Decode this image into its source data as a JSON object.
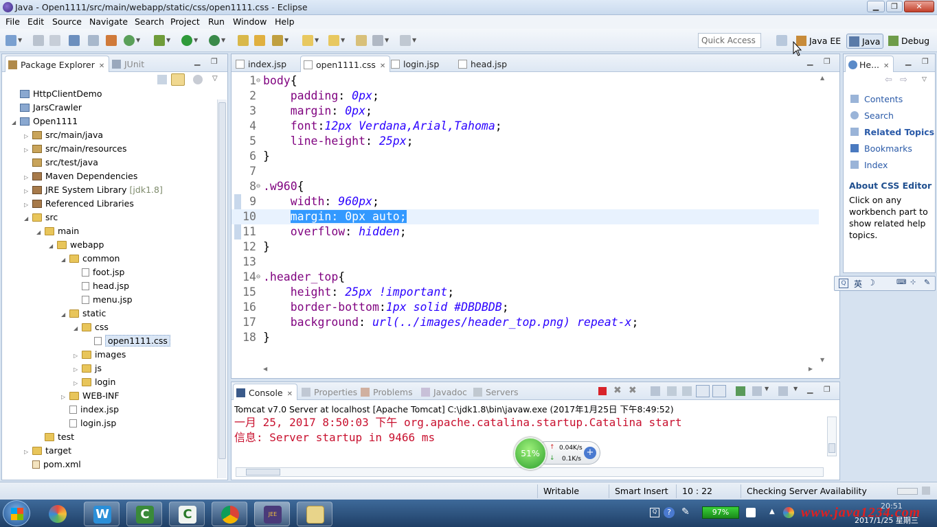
{
  "window": {
    "title": "Java - Open1111/src/main/webapp/static/css/open1111.css - Eclipse"
  },
  "menu": [
    "File",
    "Edit",
    "Source",
    "Navigate",
    "Search",
    "Project",
    "Run",
    "Window",
    "Help"
  ],
  "toolbar": {
    "quick_access": "Quick Access",
    "perspectives": [
      {
        "label": "Java EE"
      },
      {
        "label": "Java",
        "active": true
      },
      {
        "label": "Debug"
      }
    ]
  },
  "left_panel": {
    "tabs": [
      {
        "label": "Package Explorer",
        "active": true
      },
      {
        "label": "JUnit"
      }
    ],
    "tree": [
      {
        "label": "HttpClientDemo",
        "depth": 0,
        "icon": "project-icon",
        "arrow": ""
      },
      {
        "label": "JarsCrawler",
        "depth": 0,
        "icon": "project-icon",
        "arrow": ""
      },
      {
        "label": "Open1111",
        "depth": 0,
        "icon": "project-icon",
        "arrow": "expanded"
      },
      {
        "label": "src/main/java",
        "depth": 1,
        "icon": "source-folder-icon",
        "arrow": "collapsed"
      },
      {
        "label": "src/main/resources",
        "depth": 1,
        "icon": "source-folder-icon",
        "arrow": "collapsed"
      },
      {
        "label": "src/test/java",
        "depth": 1,
        "icon": "source-folder-icon",
        "arrow": ""
      },
      {
        "label": "Maven Dependencies",
        "depth": 1,
        "icon": "library-icon",
        "arrow": "collapsed"
      },
      {
        "label": "JRE System Library",
        "suffix": "[jdk1.8]",
        "depth": 1,
        "icon": "library-icon",
        "arrow": "collapsed"
      },
      {
        "label": "Referenced Libraries",
        "depth": 1,
        "icon": "library-icon",
        "arrow": "collapsed"
      },
      {
        "label": "src",
        "depth": 1,
        "icon": "folder-icon",
        "arrow": "expanded"
      },
      {
        "label": "main",
        "depth": 2,
        "icon": "folder-icon",
        "arrow": "expanded"
      },
      {
        "label": "webapp",
        "depth": 3,
        "icon": "folder-icon",
        "arrow": "expanded"
      },
      {
        "label": "common",
        "depth": 4,
        "icon": "folder-icon",
        "arrow": "expanded"
      },
      {
        "label": "foot.jsp",
        "depth": 5,
        "icon": "file-icon",
        "arrow": ""
      },
      {
        "label": "head.jsp",
        "depth": 5,
        "icon": "file-icon",
        "arrow": ""
      },
      {
        "label": "menu.jsp",
        "depth": 5,
        "icon": "file-icon",
        "arrow": ""
      },
      {
        "label": "static",
        "depth": 4,
        "icon": "folder-icon",
        "arrow": "expanded"
      },
      {
        "label": "css",
        "depth": 5,
        "icon": "folder-icon",
        "arrow": "expanded"
      },
      {
        "label": "open1111.css",
        "depth": 6,
        "icon": "file-icon",
        "arrow": "",
        "selected": true
      },
      {
        "label": "images",
        "depth": 5,
        "icon": "folder-icon",
        "arrow": "collapsed"
      },
      {
        "label": "js",
        "depth": 5,
        "icon": "folder-icon",
        "arrow": "collapsed"
      },
      {
        "label": "login",
        "depth": 5,
        "icon": "folder-icon",
        "arrow": "collapsed"
      },
      {
        "label": "WEB-INF",
        "depth": 4,
        "icon": "folder-icon",
        "arrow": "collapsed"
      },
      {
        "label": "index.jsp",
        "depth": 4,
        "icon": "file-icon",
        "arrow": ""
      },
      {
        "label": "login.jsp",
        "depth": 4,
        "icon": "file-icon",
        "arrow": ""
      },
      {
        "label": "test",
        "depth": 2,
        "icon": "folder-icon",
        "arrow": ""
      },
      {
        "label": "target",
        "depth": 1,
        "icon": "folder-icon",
        "arrow": "collapsed"
      },
      {
        "label": "pom.xml",
        "depth": 1,
        "icon": "xml-file-icon",
        "arrow": ""
      }
    ]
  },
  "editor": {
    "tabs": [
      {
        "label": "index.jsp"
      },
      {
        "label": "open1111.css",
        "active": true
      },
      {
        "label": "login.jsp"
      },
      {
        "label": "head.jsp"
      }
    ],
    "lines": [
      {
        "n": "1",
        "fold": "⊖",
        "parts": [
          {
            "t": "body",
            "c": "sel2"
          },
          {
            "t": "{",
            "c": ""
          }
        ]
      },
      {
        "n": "2",
        "parts": [
          {
            "t": "    padding",
            "c": "prop"
          },
          {
            "t": ": ",
            "c": ""
          },
          {
            "t": "0px",
            "c": "val"
          },
          {
            "t": ";",
            "c": ""
          }
        ]
      },
      {
        "n": "3",
        "parts": [
          {
            "t": "    margin",
            "c": "prop"
          },
          {
            "t": ": ",
            "c": ""
          },
          {
            "t": "0px",
            "c": "val"
          },
          {
            "t": ";",
            "c": ""
          }
        ]
      },
      {
        "n": "4",
        "parts": [
          {
            "t": "    font",
            "c": "prop"
          },
          {
            "t": ":",
            "c": ""
          },
          {
            "t": "12px Verdana,Arial,Tahoma",
            "c": "val"
          },
          {
            "t": ";",
            "c": ""
          }
        ]
      },
      {
        "n": "5",
        "parts": [
          {
            "t": "    line-height",
            "c": "prop"
          },
          {
            "t": ": ",
            "c": ""
          },
          {
            "t": "25px",
            "c": "val"
          },
          {
            "t": ";",
            "c": ""
          }
        ]
      },
      {
        "n": "6",
        "parts": [
          {
            "t": "}",
            "c": ""
          }
        ]
      },
      {
        "n": "7",
        "parts": []
      },
      {
        "n": "8",
        "fold": "⊖",
        "parts": [
          {
            "t": ".w960",
            "c": "sel2"
          },
          {
            "t": "{",
            "c": ""
          }
        ]
      },
      {
        "n": "9",
        "parts": [
          {
            "t": "    width",
            "c": "prop"
          },
          {
            "t": ": ",
            "c": ""
          },
          {
            "t": "960px",
            "c": "val"
          },
          {
            "t": ";",
            "c": ""
          }
        ]
      },
      {
        "n": "10",
        "current": true,
        "parts": [
          {
            "t": "    ",
            "c": ""
          },
          {
            "t": "margin: 0px auto;",
            "c": "hl"
          }
        ]
      },
      {
        "n": "11",
        "parts": [
          {
            "t": "    overflow",
            "c": "prop"
          },
          {
            "t": ": ",
            "c": ""
          },
          {
            "t": "hidden",
            "c": "val"
          },
          {
            "t": ";",
            "c": ""
          }
        ]
      },
      {
        "n": "12",
        "parts": [
          {
            "t": "}",
            "c": ""
          }
        ]
      },
      {
        "n": "13",
        "parts": []
      },
      {
        "n": "14",
        "fold": "⊖",
        "parts": [
          {
            "t": ".header_top",
            "c": "sel2"
          },
          {
            "t": "{",
            "c": ""
          }
        ]
      },
      {
        "n": "15",
        "parts": [
          {
            "t": "    height",
            "c": "prop"
          },
          {
            "t": ": ",
            "c": ""
          },
          {
            "t": "25px !important",
            "c": "val"
          },
          {
            "t": ";",
            "c": ""
          }
        ]
      },
      {
        "n": "16",
        "parts": [
          {
            "t": "    border-bottom",
            "c": "prop"
          },
          {
            "t": ":",
            "c": ""
          },
          {
            "t": "1px solid #DBDBDB",
            "c": "val"
          },
          {
            "t": ";",
            "c": ""
          }
        ]
      },
      {
        "n": "17",
        "parts": [
          {
            "t": "    background",
            "c": "prop"
          },
          {
            "t": ": ",
            "c": ""
          },
          {
            "t": "url(../images/header_top.png) repeat-x",
            "c": "val"
          },
          {
            "t": ";",
            "c": ""
          }
        ]
      },
      {
        "n": "18",
        "parts": [
          {
            "t": "}",
            "c": ""
          }
        ]
      }
    ]
  },
  "help_panel": {
    "tab": "He...",
    "links": [
      "Contents",
      "Search",
      "Related Topics",
      "Bookmarks",
      "Index"
    ],
    "title": "About CSS Editor",
    "text": "Click on any workbench part to show related help topics."
  },
  "console": {
    "tabs": [
      {
        "label": "Console",
        "active": true
      },
      {
        "label": "Properties"
      },
      {
        "label": "Problems"
      },
      {
        "label": "Javadoc"
      },
      {
        "label": "Servers"
      }
    ],
    "header": "Tomcat v7.0 Server at localhost [Apache Tomcat] C:\\jdk1.8\\bin\\javaw.exe (2017年1月25日 下午8:49:52)",
    "lines": [
      "一月 25, 2017 8:50:03 下午 org.apache.catalina.startup.Catalina start",
      "信息: Server startup in 9466 ms"
    ]
  },
  "speed_widget": {
    "percent": "51%",
    "up": "0.04K/s",
    "down": "0.1K/s"
  },
  "ime": {
    "label": "英"
  },
  "status": {
    "writable": "Writable",
    "insert_mode": "Smart Insert",
    "position": "10 : 22",
    "task": "Checking Server Availability"
  },
  "taskbar": {
    "battery": "97%",
    "watermark": "www.java1234.com",
    "clock_time": "20:51",
    "clock_date": "2017/1/25 星期三"
  }
}
